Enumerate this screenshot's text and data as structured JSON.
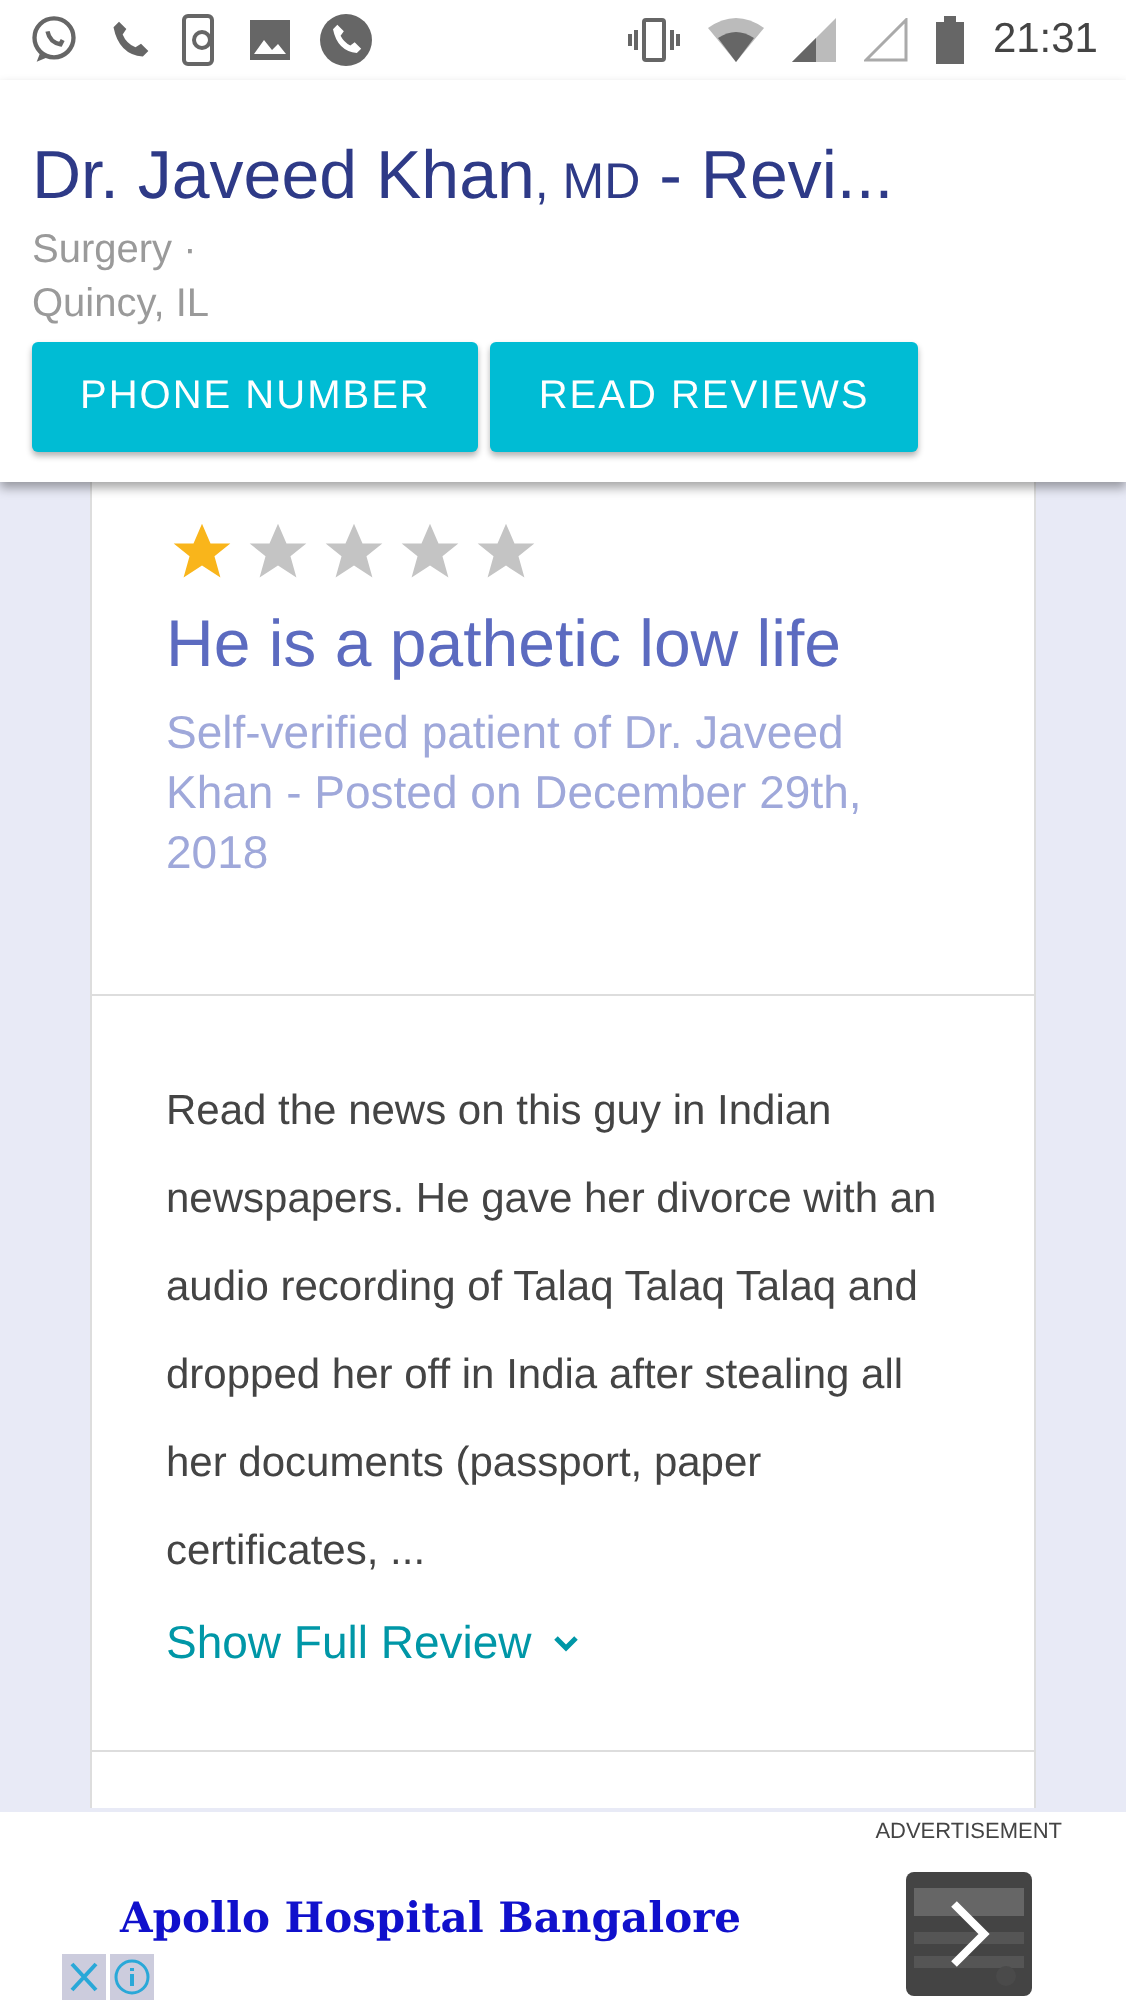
{
  "status_bar": {
    "time": "21:31"
  },
  "header": {
    "name": "Dr. Javeed Khan",
    "credential": ", MD",
    "title_rest": " - Revi...",
    "specialty": "Surgery ·",
    "location": "Quincy, IL",
    "buttons": [
      "PHONE NUMBER",
      "READ REVIEWS"
    ]
  },
  "review": {
    "stars": 1,
    "title": "He is a pathetic low life",
    "meta": "Self-verified patient of Dr. Javeed Khan - Posted on December 29th, 2018",
    "body": "Read the news on this guy in Indian newspapers. He gave her divorce with an audio recording of Talaq Talaq Talaq and dropped her off in India after stealing all her documents (passport, paper certificates, ...",
    "show_more": "Show Full Review"
  },
  "ad": {
    "label": "ADVERTISEMENT",
    "headline": "Apollo Hospital Bangalore"
  }
}
